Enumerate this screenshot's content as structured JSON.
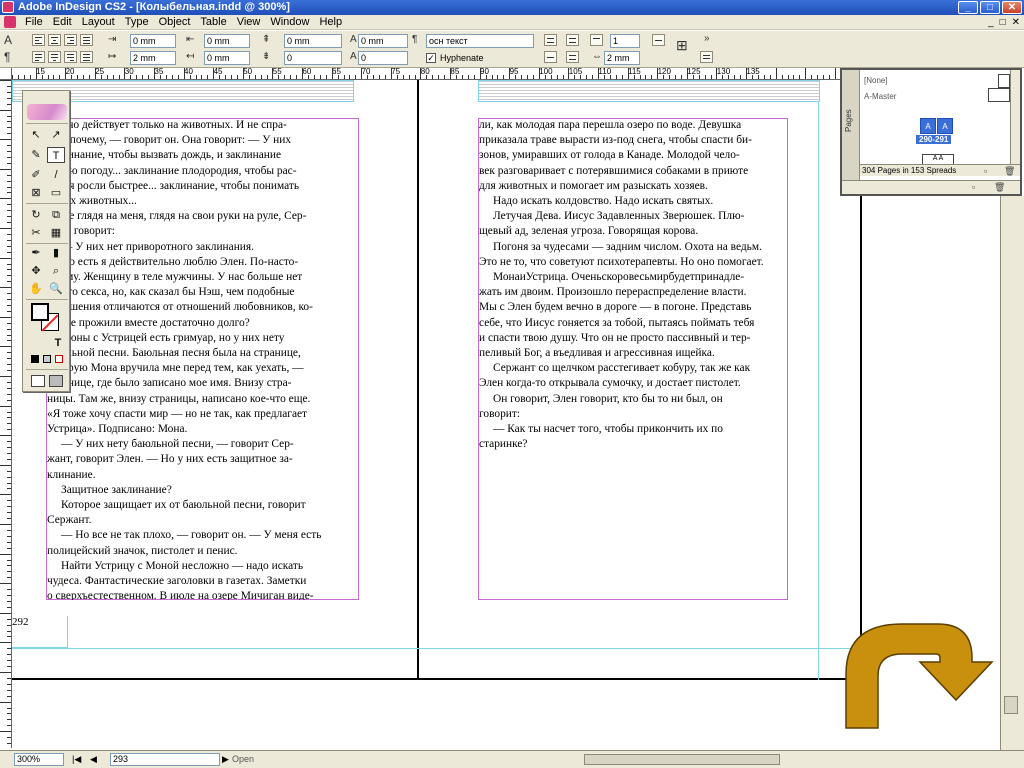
{
  "window": {
    "title": "Adobe InDesign CS2 - [Колыбельная.indd @ 300%]",
    "min_label": "_",
    "max_label": "□",
    "close_label": "✕"
  },
  "menu": [
    "File",
    "Edit",
    "Layout",
    "Type",
    "Object",
    "Table",
    "View",
    "Window",
    "Help"
  ],
  "doc_controls": [
    "_",
    "□",
    "✕"
  ],
  "control_panel": {
    "indent_left": "0 mm",
    "first_indent": "2 mm",
    "indent_right": "0 mm",
    "last_indent": "0 mm",
    "space_before": "0 mm",
    "space_after": "0",
    "drop_cap_lines": "0 mm",
    "drop_cap_chars": "0",
    "paragraph_style": "осн текст",
    "hyphenate_label": "Hyphenate",
    "hyphenate_checked": true,
    "columns": "1",
    "gutter": "2 mm",
    "pilcrow": "¶",
    "more": "»"
  },
  "ruler": {
    "numbers": [
      "15",
      "20",
      "25",
      "30",
      "35",
      "40",
      "45",
      "50",
      "55",
      "60",
      "65",
      "70",
      "75",
      "80",
      "85",
      "90",
      "95",
      "100",
      "105",
      "110",
      "115",
      "120",
      "125",
      "130",
      "135"
    ]
  },
  "left_page": {
    "paragraphs": [
      {
        "text": "но оно действует только на животных. И не спра-",
        "indent": false
      },
      {
        "text": "шай почему, — говорит он. Она говорит: — У них",
        "indent": false
      },
      {
        "text": "заклинание, чтобы вызвать дождь, и заклинание",
        "indent": false
      },
      {
        "text": "ясную погоду... заклинание плодородия, чтобы рас-",
        "indent": false
      },
      {
        "text": "тения росли быстрее... заклинание, чтобы понимать",
        "indent": false
      },
      {
        "text": "диких животных...",
        "indent": false
      },
      {
        "text": "Не глядя на меня, глядя на свои руки на руле, Сер-",
        "indent": true
      },
      {
        "text": "жант говорит:",
        "indent": false
      },
      {
        "text": "— У них нет приворотного заклинания.",
        "indent": true
      },
      {
        "text": "Но есть я действительно люблю Элен. По-насто-",
        "indent": true
      },
      {
        "text": "ящему. Женщину в теле мужчины. У нас больше нет",
        "indent": false
      },
      {
        "text": "такого секса, но, как сказал бы Нэш, чем подобные",
        "indent": false
      },
      {
        "text": "отношения отличаются от отношений любовников, ко-",
        "indent": false
      },
      {
        "text": "торые прожили вместе достаточно долго?",
        "indent": false
      },
      {
        "text": "Моны с Устрицей есть гримуар, но у них нету",
        "indent": true
      },
      {
        "text": "баюльной песни. Баюльная песня была на странице,",
        "indent": false
      },
      {
        "text": "которую Мона вручила мне перед тем, как уехать, —",
        "indent": false
      },
      {
        "text": "странице, где было записано мое имя. Внизу стра-",
        "indent": false
      },
      {
        "text": "ницы. Там же, внизу страницы, написано кое-что еще.",
        "indent": false
      },
      {
        "text": "«Я тоже хочу спасти мир — но не так, как предлагает",
        "indent": false
      },
      {
        "text": "Устрица». Подписано: Мона.",
        "indent": false
      },
      {
        "text": "— У них нету баюльной песни, — говорит Сер-",
        "indent": true
      },
      {
        "text": "жант, говорит Элен. — Но у них есть защитное за-",
        "indent": false
      },
      {
        "text": "клинание.",
        "indent": false
      },
      {
        "text": "Защитное заклинание?",
        "indent": true
      },
      {
        "text": "Которое защищает их от баюльной песни, говорит",
        "indent": true
      },
      {
        "text": "Сержант.",
        "indent": false
      },
      {
        "text": "— Но все не так плохо, — говорит он. — У меня есть",
        "indent": true
      },
      {
        "text": "полицейский значок, пистолет и пенис.",
        "indent": false
      },
      {
        "text": "Найти Устрицу с Моной несложно — надо искать",
        "indent": true
      },
      {
        "text": "чудеса. Фантастические заголовки в газетах. Заметки",
        "indent": false
      },
      {
        "text": "о сверхъестественном. В июле на озере Мичиган виде-",
        "indent": false
      }
    ],
    "page_number": "292"
  },
  "right_page": {
    "paragraphs": [
      {
        "text": "ли, как молодая пара перешла озеро по воде. Девушка",
        "indent": false
      },
      {
        "text": "приказала траве вырасти из-под снега, чтобы спасти би-",
        "indent": false
      },
      {
        "text": "зонов, умиравших от голода в Канаде. Молодой чело-",
        "indent": false
      },
      {
        "text": "век разговаривает с потерявшимися собаками в приюте",
        "indent": false
      },
      {
        "text": "для животных и помогает им разыскать хозяев.",
        "indent": false
      },
      {
        "text": "Надо искать колдовство. Надо искать святых.",
        "indent": true
      },
      {
        "text": "Летучая Дева. Иисус Задавленных Зверюшек. Плю-",
        "indent": true
      },
      {
        "text": "щевый ад, зеленая угроза. Говорящая корова.",
        "indent": false
      },
      {
        "text": "Погоня за чудесами — задним числом. Охота на ведьм.",
        "indent": true
      },
      {
        "text": "Это не то, что советуют психотерапевты. Но оно помогает.",
        "indent": false
      },
      {
        "text": "МонаиУстрица. Оченьскоровесьмирбудетпринадле-",
        "indent": true
      },
      {
        "text": "жать им двоим. Произошло перераспределение власти.",
        "indent": false
      },
      {
        "text": "Мы с Элен будем вечно в дороге — в погоне. Представь",
        "indent": false
      },
      {
        "text": "себе, что Иисус гоняется за тобой, пытаясь поймать тебя",
        "indent": false
      },
      {
        "text": "и спасти твою душу. Что он не просто пассивный и тер-",
        "indent": false
      },
      {
        "text": "пеливый Бог, а въедливая и агрессивная ищейка.",
        "indent": false
      },
      {
        "text": "Сержант со щелчком расстегивает кобуру, так же как",
        "indent": true
      },
      {
        "text": "Элен когда-то открывала сумочку, и достает пистолет.",
        "indent": false
      },
      {
        "text": "Он говорит, Элен говорит, кто бы то ни был, он",
        "indent": true
      },
      {
        "text": "говорит:",
        "indent": false
      },
      {
        "text": "— Как ты насчет того, чтобы прикончить их по",
        "indent": true
      },
      {
        "text": "старинке?",
        "indent": false
      }
    ]
  },
  "pages_panel": {
    "none_label": "[None]",
    "master_label": "A-Master",
    "spread_pages": [
      "A",
      "A"
    ],
    "spread_label": "290-291",
    "next_pages": [
      "A",
      "A"
    ],
    "footer_text": "304 Pages in 153 Spreads",
    "tab_label": "Pages"
  },
  "tools": {
    "items": [
      "↖",
      "↗",
      "✎",
      "T",
      "✐",
      "/",
      "⊠",
      "▭",
      "↻",
      "⧉",
      "✂",
      "▦",
      "✒",
      "▮",
      "✥",
      "⌕",
      "✋",
      "🔍"
    ],
    "fill_label": "T"
  },
  "status": {
    "zoom": "300%",
    "page": "293",
    "state": "Open",
    "first": "|◀",
    "prev": "◀",
    "next": "▶",
    "last": "▶|"
  },
  "colors": {
    "accent": "#3a6fd8",
    "frame": "#c46bd0",
    "guide": "#7fd6e6",
    "arrow": "#c8900c"
  },
  "icons": {
    "arrow": "curved-turn-arrow-icon"
  }
}
